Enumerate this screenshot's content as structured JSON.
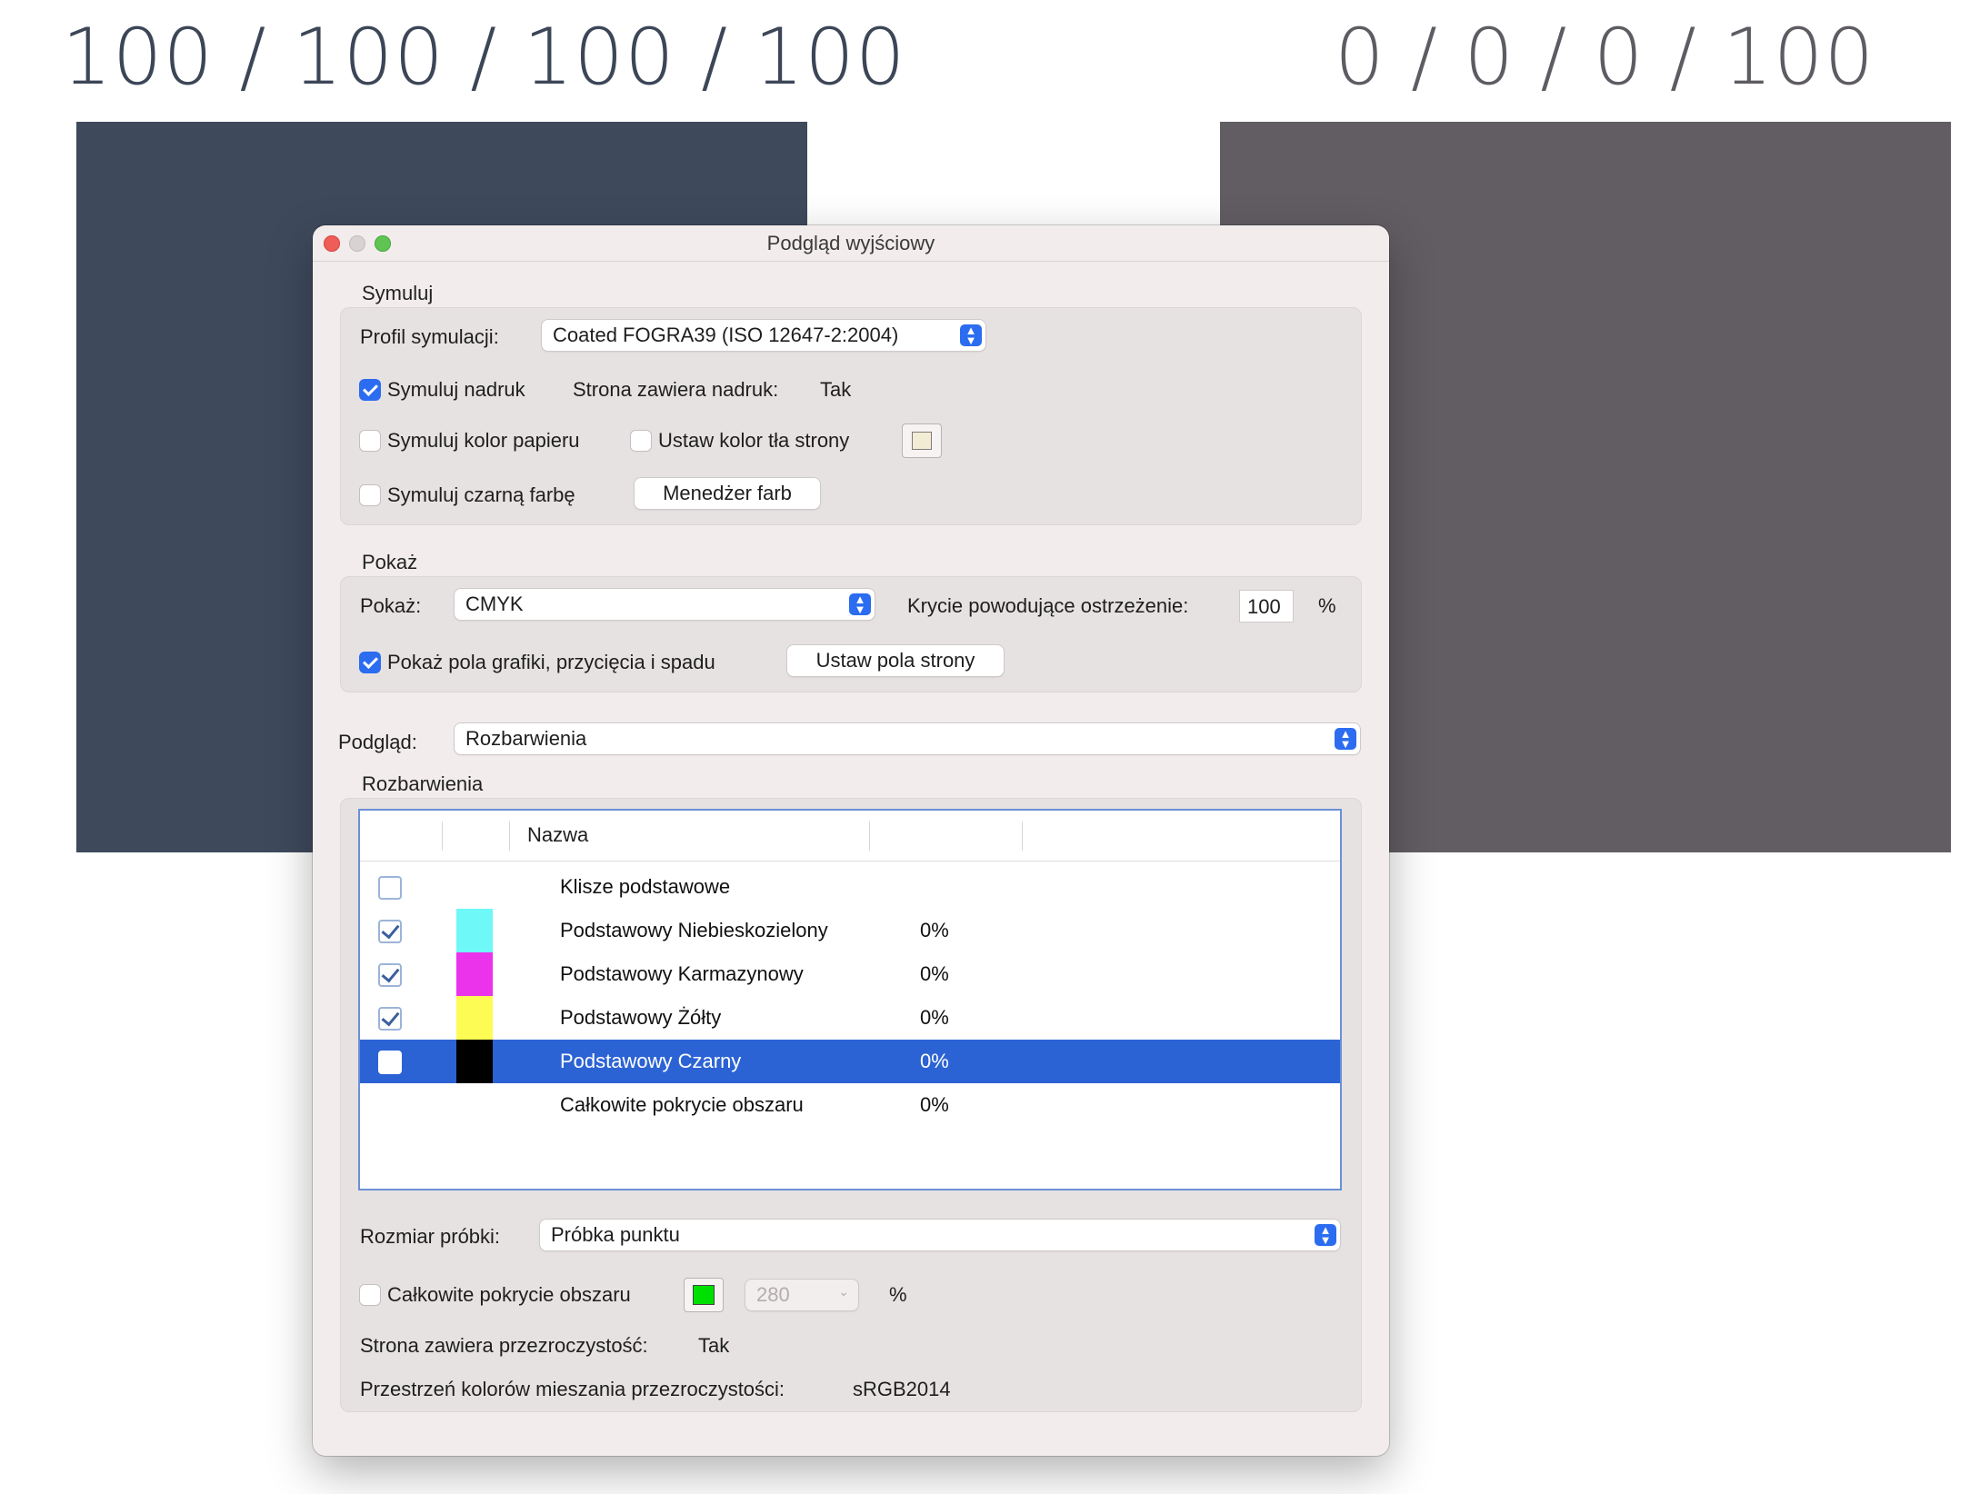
{
  "background": {
    "left_title": "100 / 100 / 100 / 100",
    "right_title": "0 / 0 / 0 / 100",
    "left_swatch_color": "#3e4a5c",
    "right_swatch_color": "#625d63"
  },
  "window": {
    "title": "Podgląd wyjściowy",
    "traffic_lights": {
      "close": "#ee5e57",
      "minimize": "#d8d2d2",
      "maximize": "#5fc454"
    }
  },
  "simulate": {
    "section_label": "Symuluj",
    "profile_label": "Profil symulacji:",
    "profile_value": "Coated FOGRA39 (ISO 12647-2:2004)",
    "overprint_label": "Symuluj nadruk",
    "overprint_checked": true,
    "page_contains_overprint_label": "Strona zawiera nadruk:",
    "page_contains_overprint_value": "Tak",
    "paper_color_label": "Symuluj kolor papieru",
    "paper_color_checked": false,
    "page_bg_label": "Ustaw kolor tła strony",
    "page_bg_checked": false,
    "black_ink_label": "Symuluj czarną farbę",
    "black_ink_checked": false,
    "ink_manager_label": "Menedżer farb"
  },
  "show": {
    "section_label": "Pokaż",
    "show_label": "Pokaż:",
    "show_value": "CMYK",
    "warning_opacity_label": "Krycie powodujące ostrzeżenie:",
    "warning_opacity_value": "100",
    "percent": "%",
    "boxes_label": "Pokaż pola grafiki, przycięcia i spadu",
    "boxes_checked": true,
    "set_boxes_label": "Ustaw pola strony"
  },
  "preview": {
    "label": "Podgląd:",
    "value": "Rozbarwienia"
  },
  "separations": {
    "section_label": "Rozbarwienia",
    "column_name": "Nazwa",
    "rows": [
      {
        "name": "Klisze podstawowe",
        "pct": "",
        "checked": false,
        "color": ""
      },
      {
        "name": "Podstawowy Niebieskozielony",
        "pct": "0%",
        "checked": true,
        "color": "#6ff8f8"
      },
      {
        "name": "Podstawowy Karmazynowy",
        "pct": "0%",
        "checked": true,
        "color": "#ec33ec"
      },
      {
        "name": "Podstawowy Żółty",
        "pct": "0%",
        "checked": true,
        "color": "#fcfc55"
      },
      {
        "name": "Podstawowy Czarny",
        "pct": "0%",
        "checked": false,
        "color": "#000000",
        "selected": true
      },
      {
        "name": "Całkowite pokrycie obszaru",
        "pct": "0%",
        "checked": null,
        "color": ""
      }
    ],
    "sample_size_label": "Rozmiar próbki:",
    "sample_size_value": "Próbka punktu",
    "total_coverage_label": "Całkowite pokrycie obszaru",
    "total_coverage_checked": false,
    "total_coverage_color": "#00e000",
    "total_coverage_value": "280",
    "percent": "%",
    "transparency_label": "Strona zawiera przezroczystość:",
    "transparency_value": "Tak",
    "blend_space_label": "Przestrzeń kolorów mieszania przezroczystości:",
    "blend_space_value": "sRGB2014"
  }
}
